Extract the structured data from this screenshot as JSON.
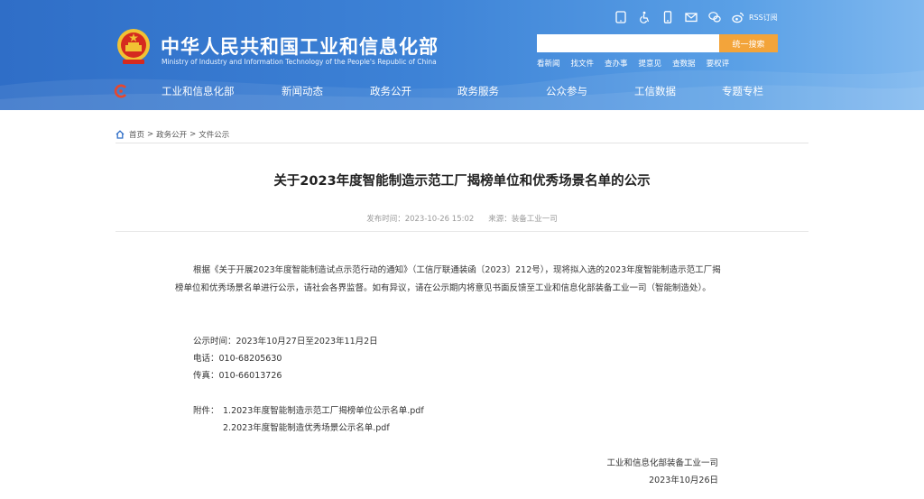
{
  "header": {
    "site_title_cn": "中华人民共和国工业和信息化部",
    "site_title_en": "Ministry of Industry and Information Technology of the People's Republic of China",
    "util_icons": [
      "pad-icon",
      "accessibility-icon",
      "mobile-icon",
      "mail-icon",
      "wechat-icon",
      "weibo-icon"
    ],
    "rss_label": "RSS订阅",
    "search_placeholder": "",
    "search_button": "统一搜索",
    "quick_links": [
      "看新闻",
      "找文件",
      "查办事",
      "提意见",
      "查数据",
      "要权评"
    ],
    "nav": [
      {
        "label": "工业和信息化部"
      },
      {
        "label": "新闻动态"
      },
      {
        "label": "政务公开"
      },
      {
        "label": "政务服务"
      },
      {
        "label": "公众参与"
      },
      {
        "label": "工信数据"
      },
      {
        "label": "专题专栏"
      }
    ]
  },
  "breadcrumb": {
    "items": [
      "首页",
      "政务公开",
      "文件公示"
    ],
    "separator": ">"
  },
  "article": {
    "title": "关于2023年度智能制造示范工厂揭榜单位和优秀场景名单的公示",
    "publish_time": "发布时间：2023-10-26 15:02",
    "source": "来源：装备工业一司",
    "paragraph1": "根据《关于开展2023年度智能制造试点示范行动的通知》（工信厅联通装函〔2023〕212号），现将拟入选的2023年度智能制造示范工厂揭榜单位和优秀场景名单进行公示，请社会各界监督。如有异议，请在公示期内将意见书面反馈至工业和信息化部装备工业一司（智能制造处）。",
    "notice_period": "公示时间：2023年10月27日至2023年11月2日",
    "phone": "电话：010-68205630",
    "fax": "传真：010-66013726",
    "attachment_label": "附件：",
    "attachment_1": "1.2023年度智能制造示范工厂揭榜单位公示名单.pdf",
    "attachment_2": "2.2023年度智能制造优秀场景公示名单.pdf",
    "signature_org": "工业和信息化部装备工业一司",
    "signature_date": "2023年10月26日"
  },
  "colors": {
    "header_blue": "#2f6ec7",
    "search_button": "#f3a43a",
    "emblem_red": "#d52a1f",
    "emblem_gold": "#f1c233"
  }
}
